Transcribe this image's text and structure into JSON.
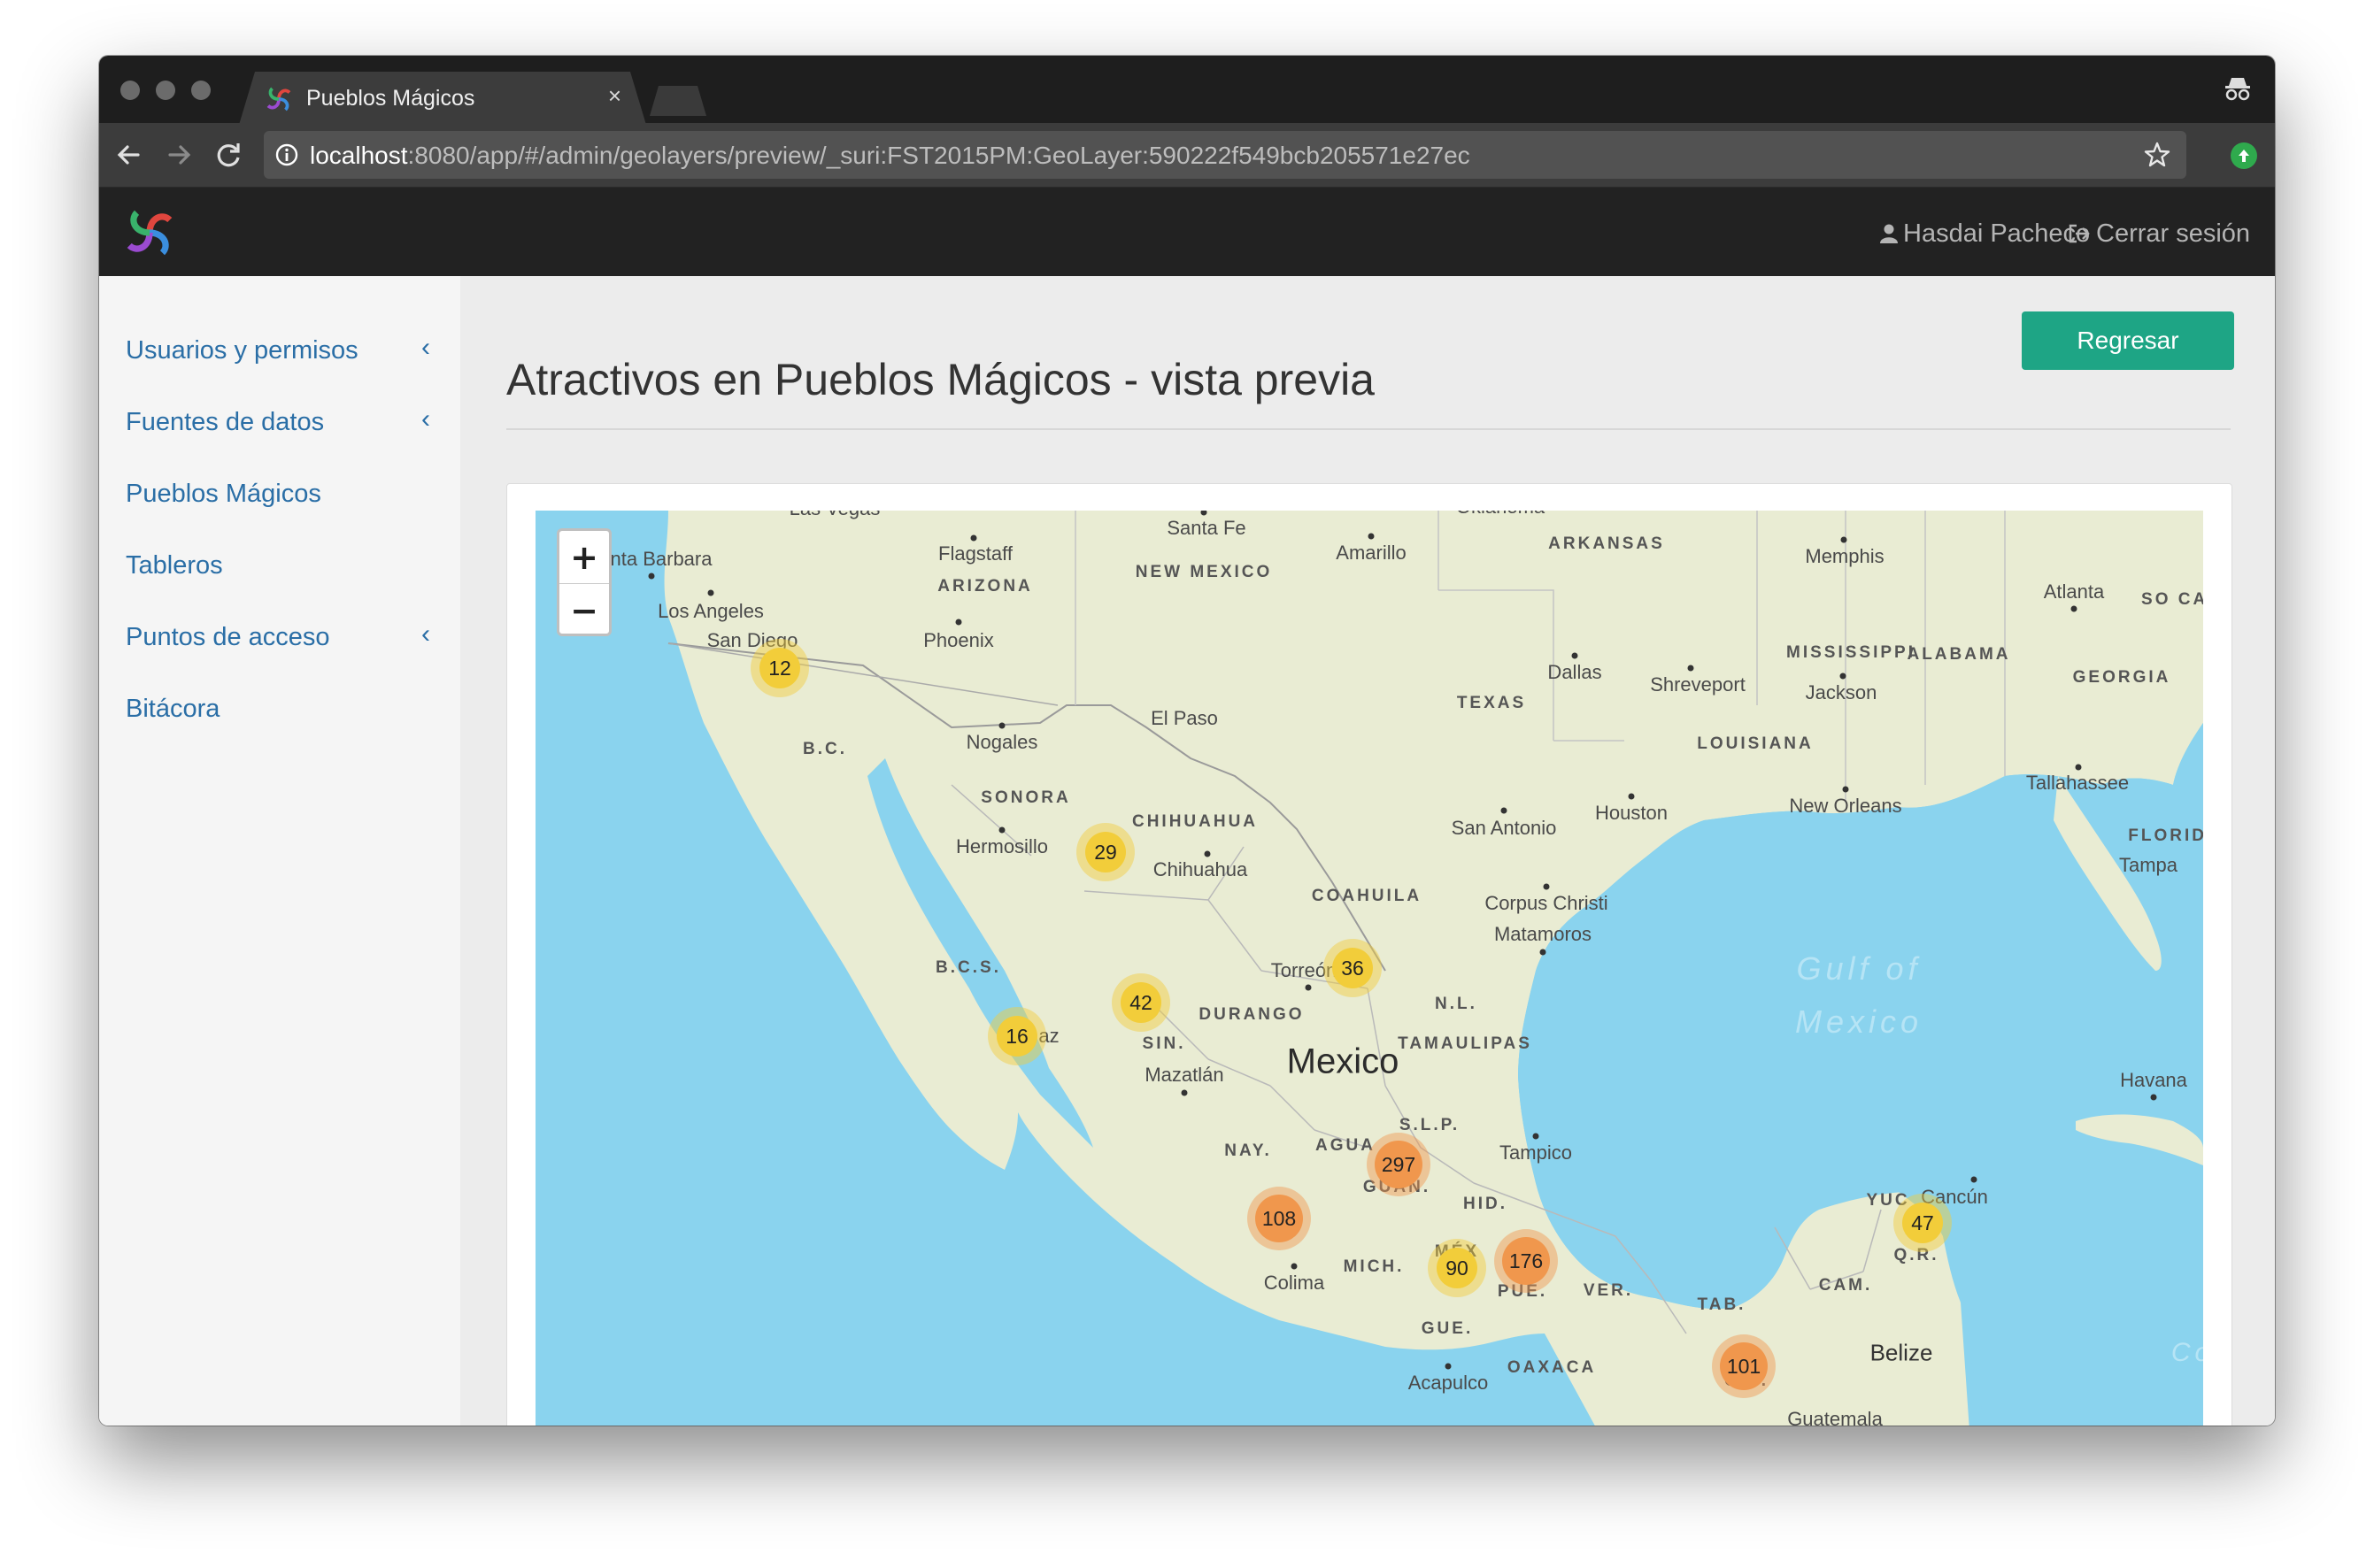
{
  "browser": {
    "tab_title": "Pueblos Mágicos",
    "tab_close": "×",
    "url_host": "localhost",
    "url_rest": ":8080/app/#/admin/geolayers/preview/_suri:FST2015PM:GeoLayer:590222f549bcb205571e27ec",
    "icons": [
      "back-arrow-icon",
      "forward-arrow-icon",
      "reload-icon",
      "info-icon",
      "star-icon",
      "incognito-icon"
    ]
  },
  "navbar": {
    "user_name": "Hasdai Pacheco",
    "logout_label": "Cerrar sesión"
  },
  "sidebar": {
    "items": [
      {
        "label": "Usuarios y permisos",
        "has_submenu": true
      },
      {
        "label": "Fuentes de datos",
        "has_submenu": true
      },
      {
        "label": "Pueblos Mágicos",
        "has_submenu": false
      },
      {
        "label": "Tableros",
        "has_submenu": false
      },
      {
        "label": "Puntos de acceso",
        "has_submenu": true
      },
      {
        "label": "Bitácora",
        "has_submenu": false
      }
    ],
    "chevron": "‹"
  },
  "page": {
    "title": "Atractivos en Pueblos Mágicos - vista previa",
    "back_button": "Regresar"
  },
  "map": {
    "zoom_in": "+",
    "zoom_out": "−",
    "colors": {
      "water": "#8ad3ee",
      "land": "#e9ecd3",
      "cluster_small": "#f2cd3a",
      "cluster_large": "#f0974d"
    },
    "labels": {
      "states": [
        "ARIZONA",
        "NEW MEXICO",
        "TEXAS",
        "ARKANSAS",
        "MISSISSIPPI",
        "ALABAMA",
        "GEORGIA",
        "LOUISIANA",
        "FLORIDA",
        "SO CAR",
        "SONORA",
        "CHIHUAHUA",
        "COAHUILA",
        "B.C.",
        "B.C.S.",
        "DURANGO",
        "SIN.",
        "N.L.",
        "TAMAULIPAS",
        "S.L.P.",
        "NAY.",
        "AGUA",
        "GUAN.",
        "HID.",
        "MICH.",
        "MÉX",
        "PUE.",
        "VER.",
        "GUE.",
        "OAXACA",
        "TAB.",
        "CAM.",
        "YUC",
        "Q.R.",
        "CHI."
      ],
      "cities": [
        "Flagstaff",
        "Santa Fe",
        "Amarillo",
        "Memphis",
        "Atlanta",
        "nta Barbara",
        "Los Angeles",
        "San Diego",
        "Phoenix",
        "Dallas",
        "Shreveport",
        "Jackson",
        "Nogales",
        "El Paso",
        "Tallahassee",
        "New Orleans",
        "Houston",
        "San Antonio",
        "Hermosillo",
        "Chihuahua",
        "Tampa",
        "Corpus Christi",
        "Matamoros",
        "Torreón",
        "Mazatlán",
        "Havana",
        "Tampico",
        "Cancún",
        "Colima",
        "Acapulco",
        "Guatemala",
        "Las Vegas",
        "Oklahoma"
      ],
      "country": "Mexico",
      "sea": [
        "Gulf of",
        "Mexico"
      ],
      "fragment_paz": "az",
      "fragment_co": "Co",
      "country2": "Belize"
    },
    "clusters": [
      {
        "count": "12",
        "size": "small"
      },
      {
        "count": "29",
        "size": "small"
      },
      {
        "count": "36",
        "size": "small"
      },
      {
        "count": "42",
        "size": "small"
      },
      {
        "count": "16",
        "size": "small"
      },
      {
        "count": "297",
        "size": "large"
      },
      {
        "count": "108",
        "size": "large"
      },
      {
        "count": "90",
        "size": "small"
      },
      {
        "count": "176",
        "size": "large"
      },
      {
        "count": "47",
        "size": "small"
      },
      {
        "count": "101",
        "size": "large"
      }
    ]
  }
}
